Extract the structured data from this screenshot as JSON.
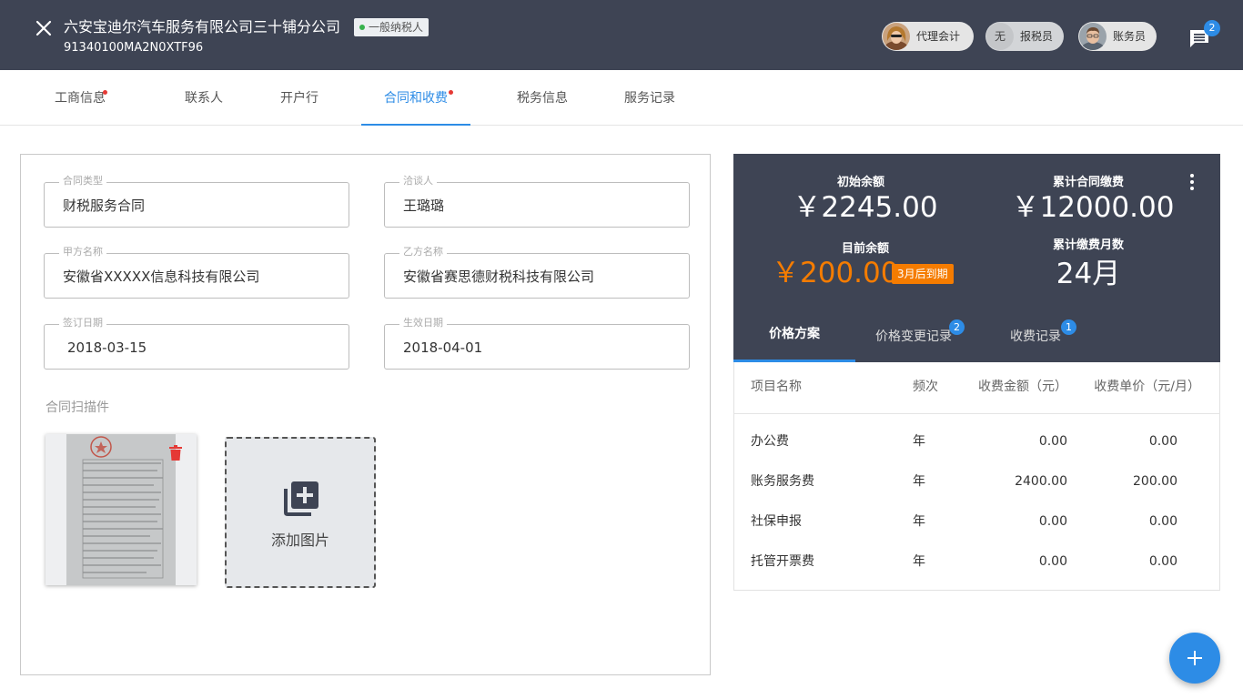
{
  "header": {
    "company_name": "六安宝迪尔汽车服务有限公司三十铺分公司",
    "taxpayer_type": "一般纳税人",
    "company_code": "91340100MA2N0XTF96",
    "staff": [
      {
        "label": "代理会计"
      },
      {
        "label": "报税员",
        "avatar_text": "无"
      },
      {
        "label": "账务员"
      }
    ],
    "message_count": "2"
  },
  "tabs": [
    {
      "label": "工商信息",
      "has_dot": true
    },
    {
      "label": "联系人"
    },
    {
      "label": "开户行"
    },
    {
      "label": "合同和收费",
      "has_dot": true,
      "active": true
    },
    {
      "label": "税务信息"
    },
    {
      "label": "服务记录"
    }
  ],
  "contract": {
    "type": {
      "label": "合同类型",
      "value": "财税服务合同"
    },
    "negotiator": {
      "label": "洽谈人",
      "value": "王璐璐"
    },
    "party_a": {
      "label": "甲方名称",
      "value": "安徽省XXXXX信息科技有限公司"
    },
    "party_b": {
      "label": "乙方名称",
      "value": "安徽省赛思德财税科技有限公司"
    },
    "sign_date": {
      "label": "签订日期",
      "value": "2018-03-15"
    },
    "effective_date": {
      "label": "生效日期",
      "value": "2018-04-01"
    },
    "scans_label": "合同扫描件",
    "add_image_label": "添加图片"
  },
  "balance": {
    "initial_label": "初始余额",
    "initial_value": "￥2245.00",
    "total_paid_label": "累计合同缴费",
    "total_paid_value": "￥12000.00",
    "current_label": "目前余额",
    "current_value": "￥200.00",
    "expire_badge": "3月后到期",
    "months_label": "累计缴费月数",
    "months_value": "24月"
  },
  "panel_tabs": [
    {
      "label": "价格方案",
      "active": true
    },
    {
      "label": "价格变更记录",
      "badge": "2"
    },
    {
      "label": "收费记录",
      "badge": "1"
    }
  ],
  "price_table": {
    "headers": [
      "项目名称",
      "频次",
      "收费金额（元）",
      "收费单价（元/月）"
    ],
    "rows": [
      {
        "name": "办公费",
        "freq": "年",
        "amount": "0.00",
        "unit": "0.00"
      },
      {
        "name": "账务服务费",
        "freq": "年",
        "amount": "2400.00",
        "unit": "200.00"
      },
      {
        "name": "社保申报",
        "freq": "年",
        "amount": "0.00",
        "unit": "0.00"
      },
      {
        "name": "托管开票费",
        "freq": "年",
        "amount": "0.00",
        "unit": "0.00"
      }
    ]
  },
  "colors": {
    "header_bg": "#3e4454",
    "accent": "#2d8ce6",
    "warning": "#f57c00",
    "dot": "#e53935"
  }
}
